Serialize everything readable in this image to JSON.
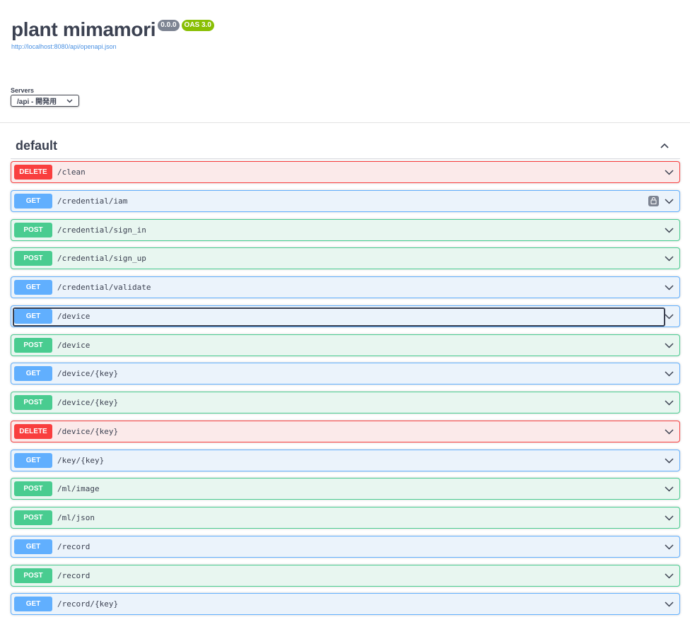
{
  "info": {
    "title": "plant mimamori",
    "version": "0.0.0",
    "oas": "OAS 3.0",
    "spec_url": "http://localhost:8080/api/openapi.json"
  },
  "servers": {
    "label": "Servers",
    "selected": "/api - 開発用"
  },
  "tag": {
    "name": "default"
  },
  "operations": [
    {
      "method": "DELETE",
      "path": "/clean"
    },
    {
      "method": "GET",
      "path": "/credential/iam",
      "locked": true
    },
    {
      "method": "POST",
      "path": "/credential/sign_in"
    },
    {
      "method": "POST",
      "path": "/credential/sign_up"
    },
    {
      "method": "GET",
      "path": "/credential/validate"
    },
    {
      "method": "GET",
      "path": "/device",
      "focused": true
    },
    {
      "method": "POST",
      "path": "/device"
    },
    {
      "method": "GET",
      "path": "/device/{key}"
    },
    {
      "method": "POST",
      "path": "/device/{key}"
    },
    {
      "method": "DELETE",
      "path": "/device/{key}"
    },
    {
      "method": "GET",
      "path": "/key/{key}"
    },
    {
      "method": "POST",
      "path": "/ml/image"
    },
    {
      "method": "POST",
      "path": "/ml/json"
    },
    {
      "method": "GET",
      "path": "/record"
    },
    {
      "method": "POST",
      "path": "/record"
    },
    {
      "method": "GET",
      "path": "/record/{key}"
    }
  ],
  "colors": {
    "get": "#61affe",
    "post": "#49cc90",
    "delete": "#f93e3e",
    "text": "#3b4151"
  }
}
